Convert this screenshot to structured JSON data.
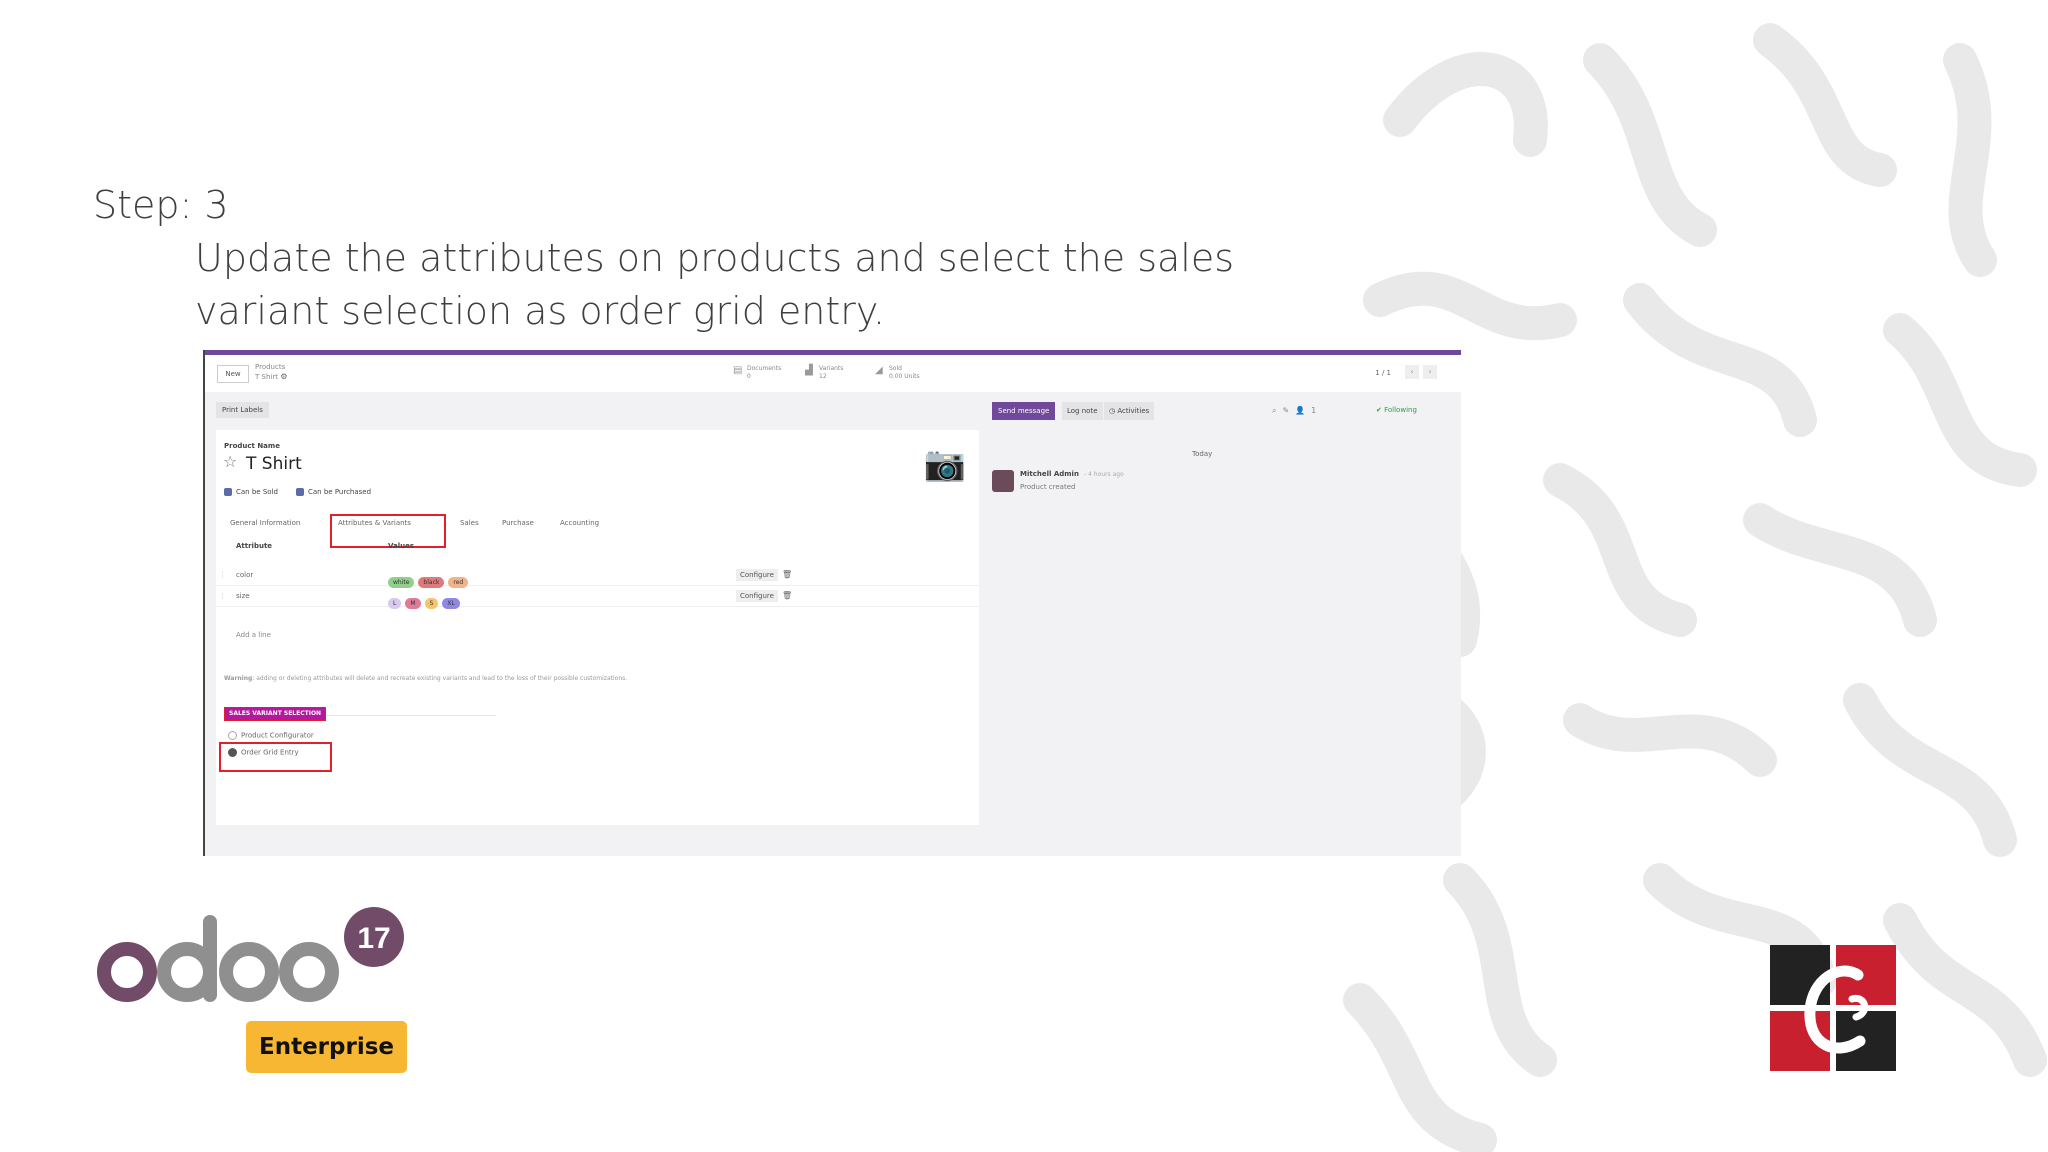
{
  "slide": {
    "step_label": "Step: 3",
    "description": "Update the attributes on products and select the sales variant selection as order grid entry."
  },
  "odoo_ui": {
    "control_panel": {
      "new_button": "New",
      "breadcrumb_parent": "Products",
      "breadcrumb_current": "T Shirt",
      "stats": [
        {
          "label": "Documents",
          "value": "0",
          "icon": "document-icon"
        },
        {
          "label": "Variants",
          "value": "12",
          "icon": "bar-chart-icon"
        },
        {
          "label": "Sold",
          "value": "0.00 Units",
          "icon": "trend-icon"
        }
      ],
      "pager": "1 / 1"
    },
    "form": {
      "print_labels_button": "Print Labels",
      "product_name_label": "Product Name",
      "product_name": "T Shirt",
      "can_be_sold": "Can be Sold",
      "can_be_purchased": "Can be Purchased",
      "tabs": [
        "General Information",
        "Attributes & Variants",
        "Sales",
        "Purchase",
        "Accounting"
      ],
      "active_tab": "Attributes & Variants",
      "table_headers": {
        "attribute": "Attribute",
        "values": "Values"
      },
      "rows": [
        {
          "attribute": "color",
          "values": [
            {
              "label": "white",
              "color": "#8fd18b"
            },
            {
              "label": "black",
              "color": "#e07a7a"
            },
            {
              "label": "red",
              "color": "#f0b38a"
            }
          ],
          "configure": "Configure"
        },
        {
          "attribute": "size",
          "values": [
            {
              "label": "L",
              "color": "#d7c9f0"
            },
            {
              "label": "M",
              "color": "#e07a9a"
            },
            {
              "label": "S",
              "color": "#f5c56b"
            },
            {
              "label": "XL",
              "color": "#8f86e6"
            }
          ],
          "configure": "Configure"
        }
      ],
      "add_line": "Add a line",
      "warning_title": "Warning",
      "warning_text": "adding or deleting attributes will delete and recreate existing variants and lead to the loss of their possible customizations.",
      "sales_variant_selection_title": "SALES VARIANT SELECTION",
      "options": [
        "Product Configurator",
        "Order Grid Entry"
      ],
      "selected_option": "Order Grid Entry"
    },
    "chatter": {
      "send_message": "Send message",
      "log_note": "Log note",
      "activities": "Activities",
      "following": "Following",
      "follower_count": "1",
      "today": "Today",
      "message_author": "Mitchell Admin",
      "message_time": "- 4 hours ago",
      "message_body": "Product created"
    }
  },
  "logos": {
    "odoo_version": "17",
    "odoo_edition": "Enterprise",
    "odoo_wordmark": "odoo"
  },
  "colors": {
    "odoo_purple": "#71499a",
    "highlight_red": "#e0202a",
    "enterprise_yellow": "#f7b733",
    "brand_dark": "#222222",
    "brand_red": "#c8202e"
  }
}
